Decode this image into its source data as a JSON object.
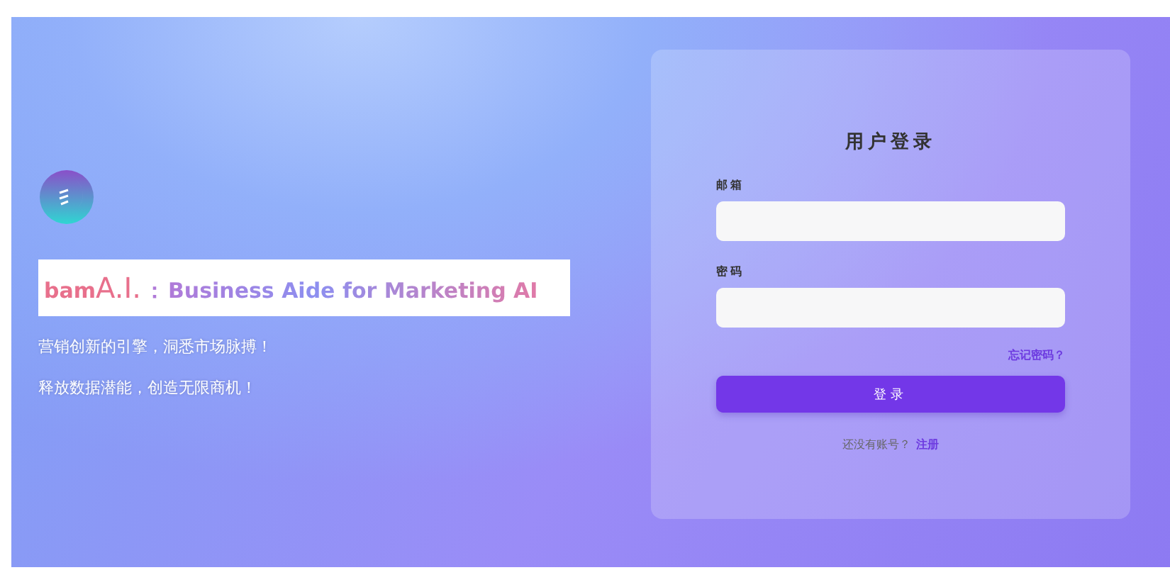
{
  "brand": {
    "prefix": "bam",
    "highlight": "A.I.",
    "separator": "：",
    "tagline": "Business Aide for Marketing AI"
  },
  "slogans": [
    "营销创新的引擎，洞悉市场脉搏！",
    "释放数据潜能，创造无限商机！"
  ],
  "login": {
    "title": "用户登录",
    "fields": [
      {
        "label": "邮箱"
      },
      {
        "label": "密码"
      }
    ],
    "forgot": "忘记密码？",
    "submit": "登录",
    "signup_prompt": "还没有账号？",
    "signup_link": "注册"
  }
}
